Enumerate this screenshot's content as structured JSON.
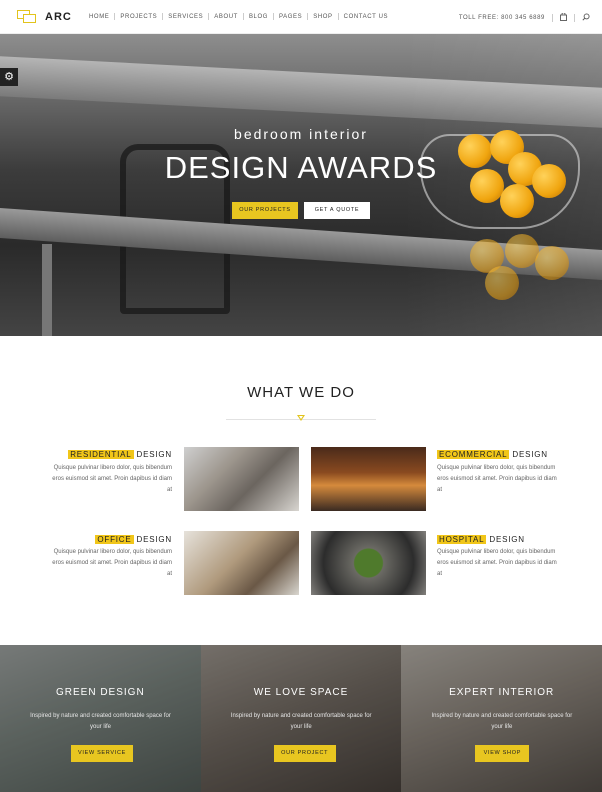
{
  "header": {
    "logo_text": "ARC",
    "nav": [
      "HOME",
      "PROJECTS",
      "SERVICES",
      "ABOUT",
      "BLOG",
      "PAGES",
      "SHOP",
      "CONTACT US"
    ],
    "toll_free": "TOLL FREE: 800 345 6889",
    "cart_icon": "bag-icon",
    "search_icon": "search-icon"
  },
  "hero": {
    "subtitle": "bedroom interior",
    "title": "DESIGN AWARDS",
    "primary_button": "OUR PROJECTS",
    "secondary_button": "GET A QUOTE",
    "settings_icon": "gear-icon"
  },
  "what_we_do": {
    "title": "WHAT WE DO",
    "services": [
      {
        "highlight": "RESIDENTIAL",
        "rest": " DESIGN",
        "text": "Quisque pulvinar libero dolor, quis bibendum eros euismod sit amet. Proin dapibus id diam at"
      },
      {
        "highlight": "ECOMMERCIAL",
        "rest": " DESIGN",
        "text": "Quisque pulvinar libero dolor, quis bibendum eros euismod sit amet. Proin dapibus id diam at"
      },
      {
        "highlight": "OFFICE",
        "rest": " DESIGN",
        "text": "Quisque pulvinar libero dolor, quis bibendum eros euismod sit amet. Proin dapibus id diam at"
      },
      {
        "highlight": "HOSPITAL",
        "rest": " DESIGN",
        "text": "Quisque pulvinar libero dolor, quis bibendum eros euismod sit amet. Proin dapibus id diam at"
      }
    ]
  },
  "bottom": [
    {
      "title": "GREEN DESIGN",
      "text": "Inspired by nature and created comfortable space for your life",
      "button": "VIEW SERVICE"
    },
    {
      "title": "WE LOVE SPACE",
      "text": "Inspired by nature and created comfortable space for your life",
      "button": "OUR PROJECT"
    },
    {
      "title": "EXPERT INTERIOR",
      "text": "Inspired by nature and created comfortable space for your life",
      "button": "VIEW SHOP"
    }
  ],
  "colors": {
    "accent": "#e8c620",
    "highlight": "#f1c619",
    "text_dark": "#222222",
    "text_muted": "#666666"
  }
}
